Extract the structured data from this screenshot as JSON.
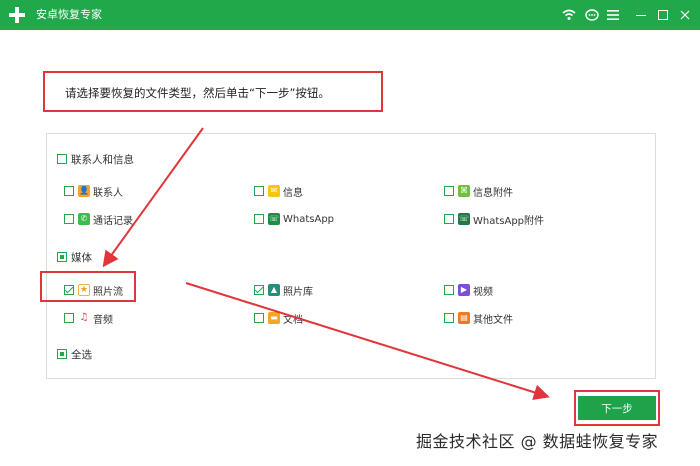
{
  "app": {
    "title": "安卓恢复专家"
  },
  "instruction": "请选择要恢复的文件类型，然后单击“下一步”按钮。",
  "groups": {
    "contacts": {
      "label": "联系人和信息",
      "items": [
        "联系人",
        "信息",
        "信息附件",
        "通话记录",
        "WhatsApp",
        "WhatsApp附件"
      ]
    },
    "media": {
      "label": "媒体",
      "items": [
        "照片流",
        "照片库",
        "视频",
        "音频",
        "文档",
        "其他文件"
      ]
    },
    "select_all": "全选"
  },
  "next_button": "下一步",
  "watermark": "掘金技术社区 @ 数据蛙恢复专家",
  "colors": {
    "brand": "#20a84a",
    "highlight": "#e0353a"
  },
  "icons": [
    "wifi-icon",
    "chat-icon",
    "menu-icon",
    "minimize-icon",
    "maximize-icon",
    "close-icon"
  ]
}
